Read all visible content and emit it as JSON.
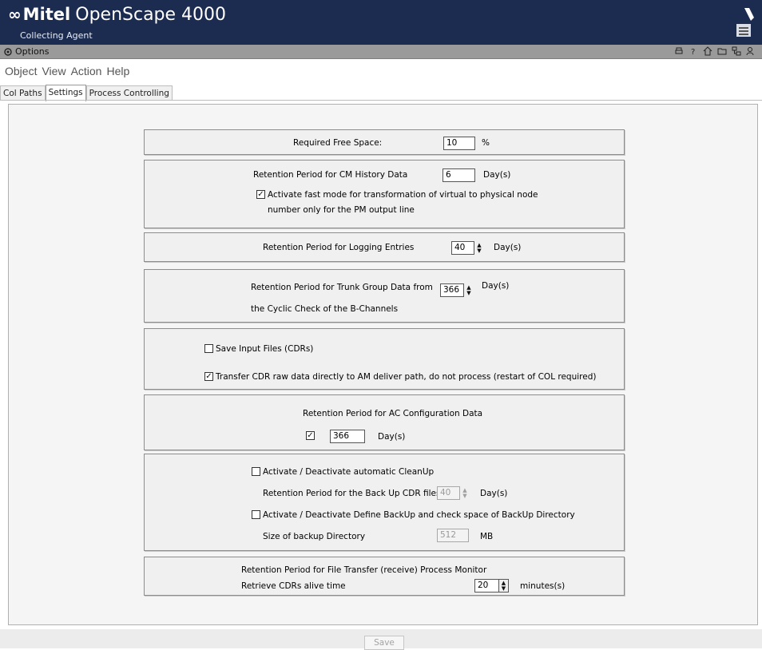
{
  "header": {
    "brand": "Mitel",
    "product": "OpenScape 4000",
    "subtitle": "Collecting Agent"
  },
  "options_bar": {
    "label": "Options"
  },
  "menu": [
    "Object",
    "View",
    "Action",
    "Help"
  ],
  "tabs": [
    {
      "label": "Col Paths"
    },
    {
      "label": "Settings"
    },
    {
      "label": "Process Controlling"
    }
  ],
  "settings": {
    "free_space": {
      "label": "Required Free Space:",
      "value": "10",
      "unit": "%"
    },
    "cm_history": {
      "label": "Retention Period for CM History Data",
      "value": "6",
      "unit": "Day(s)",
      "fast_mode_line1": "Activate fast mode for transformation of virtual to physical node",
      "fast_mode_line2": "number only for the PM output line",
      "fast_mode_checked": "✓"
    },
    "logging": {
      "label": "Retention Period for Logging Entries",
      "value": "40",
      "unit": "Day(s)"
    },
    "trunk_group": {
      "label_line1": "Retention Period for Trunk Group Data from",
      "label_line2": "the Cyclic Check of the B-Channels",
      "value": "366",
      "unit": "Day(s)"
    },
    "input_files": {
      "save_label": "Save Input Files (CDRs)",
      "transfer_label": "Transfer CDR raw data directly to AM deliver path, do not process (restart of COL required)",
      "transfer_checked": "✓"
    },
    "ac_config": {
      "label": "Retention Period for AC Configuration Data",
      "checked": "✓",
      "value": "366",
      "unit": "Day(s)"
    },
    "cleanup": {
      "auto_label": "Activate / Deactivate automatic CleanUp",
      "backup_retention_label": "Retention Period for the Back Up CDR files",
      "backup_retention_value": "40",
      "backup_retention_unit": "Day(s)",
      "define_backup_label": "Activate / Deactivate Define BackUp and check space of BackUp Directory",
      "size_label": "Size of backup Directory",
      "size_value": "512",
      "size_unit": "MB"
    },
    "file_transfer": {
      "label": "Retention Period for File Transfer (receive) Process Monitor",
      "alive_label": "Retrieve CDRs alive time",
      "alive_value": "20",
      "alive_unit": "minutes(s)"
    }
  },
  "footer": {
    "save_label": "Save"
  },
  "colors": {
    "header_bg": "#1c2b50",
    "options_bg": "#9a9a9a"
  }
}
